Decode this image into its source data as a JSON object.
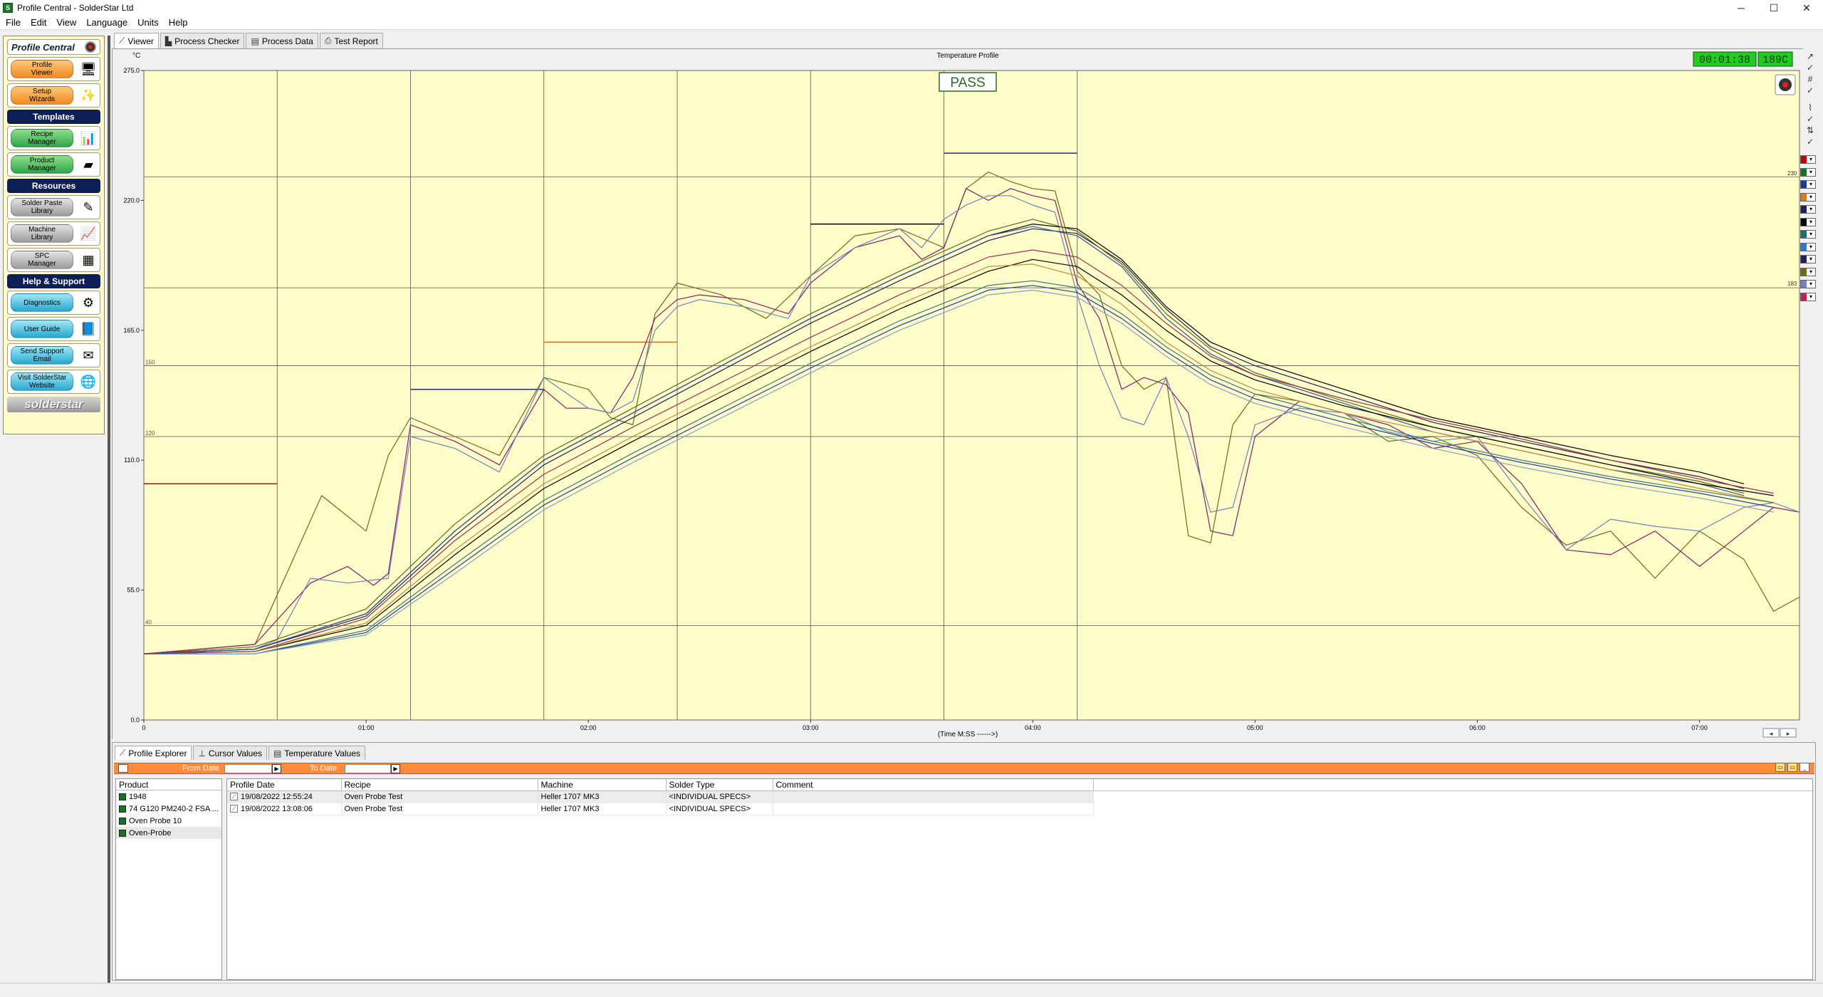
{
  "window": {
    "title": "Profile Central - SolderStar Ltd",
    "app_icon": "S",
    "controls": [
      "─",
      "☐",
      "✕"
    ]
  },
  "menu": [
    "File",
    "Edit",
    "View",
    "Language",
    "Units",
    "Help"
  ],
  "sidebar": {
    "header": "Profile Central",
    "buttons": [
      {
        "label": "Profile\nViewer",
        "color": "orange",
        "icon": "profile-viewer-icon"
      },
      {
        "label": "Setup\nWizards",
        "color": "orange",
        "icon": "wand-icon"
      }
    ],
    "templates_header": "Templates",
    "templates": [
      {
        "label": "Recipe\nManager",
        "color": "green",
        "icon": "recipe-icon"
      },
      {
        "label": "Product\nManager",
        "color": "green",
        "icon": "board-icon"
      }
    ],
    "resources_header": "Resources",
    "resources": [
      {
        "label": "Solder Paste\nLibrary",
        "color": "grey",
        "icon": "paste-icon"
      },
      {
        "label": "Machine\nLibrary",
        "color": "grey",
        "icon": "machine-icon"
      },
      {
        "label": "SPC\nManager",
        "color": "grey",
        "icon": "spc-icon"
      }
    ],
    "help_header": "Help & Support",
    "help": [
      {
        "label": "Diagnostics",
        "color": "blue",
        "icon": "diagnostics-icon"
      },
      {
        "label": "User Guide",
        "color": "blue",
        "icon": "guide-icon"
      },
      {
        "label": "Send Support\nEmail",
        "color": "blue",
        "icon": "email-icon"
      },
      {
        "label": "Visit SolderStar\nWebsite",
        "color": "blue",
        "icon": "globe-icon"
      }
    ],
    "logo": "solderstar"
  },
  "tabs": [
    {
      "label": "Viewer",
      "active": true,
      "icon": "viewer-icon"
    },
    {
      "label": "Process Checker",
      "active": false,
      "icon": "bar-chart-icon"
    },
    {
      "label": "Process Data",
      "active": false,
      "icon": "table-icon"
    },
    {
      "label": "Test Report",
      "active": false,
      "icon": "printer-icon"
    }
  ],
  "graph": {
    "title": "Temperature Profile",
    "status": "PASS",
    "time_readout": "00:01:38",
    "temp_readout": "189C",
    "xlabel": "(Time M:SS ------>)",
    "ylabel": "°C"
  },
  "chart_data": {
    "type": "line",
    "title": "Temperature Profile",
    "xlabel": "(Time M:SS ------>)",
    "ylabel": "°C",
    "xlim": [
      0,
      447
    ],
    "ylim": [
      0,
      275
    ],
    "y_ticks": [
      "0.0",
      "55.0",
      "110.0",
      "165.0",
      "220.0",
      "275.0"
    ],
    "x_ticks": [
      "0",
      "01:00",
      "02:00",
      "03:00",
      "04:00",
      "05:00",
      "06:00",
      "07:00"
    ],
    "x_tick_values": [
      0,
      60,
      120,
      180,
      240,
      300,
      360,
      420
    ],
    "threshold_labels": [
      {
        "y": 40,
        "label": "40"
      },
      {
        "y": 120,
        "label": "120"
      },
      {
        "y": 150,
        "label": "150"
      }
    ],
    "reference_lines": [
      40,
      120,
      150,
      183,
      230
    ],
    "zone_boundaries_s": [
      36,
      72,
      108,
      144,
      180,
      216,
      252
    ],
    "zone_setpoints": [
      {
        "x0": 0,
        "x1": 36,
        "y": 100,
        "color": "#c00000"
      },
      {
        "x0": 72,
        "x1": 108,
        "y": 140,
        "color": "#203080"
      },
      {
        "x0": 108,
        "x1": 144,
        "y": 160,
        "color": "#d07020"
      },
      {
        "x0": 180,
        "x1": 216,
        "y": 210,
        "color": "#000000"
      },
      {
        "x0": 216,
        "x1": 252,
        "y": 240,
        "color": "#203080"
      }
    ],
    "grid": true,
    "series": [
      {
        "color": "#6b6b1a",
        "x": [
          0,
          30,
          48,
          60,
          66,
          72,
          84,
          96,
          108,
          120,
          126,
          132,
          138,
          144,
          156,
          168,
          180,
          192,
          204,
          216,
          222,
          228,
          234,
          240,
          246,
          252,
          258,
          264,
          270,
          276,
          282,
          288,
          294,
          300,
          312,
          324,
          336,
          348,
          360,
          372,
          384,
          396,
          408,
          420,
          432,
          440,
          447
        ],
        "y": [
          28,
          32,
          95,
          80,
          112,
          128,
          120,
          112,
          145,
          140,
          128,
          125,
          172,
          185,
          180,
          170,
          188,
          205,
          208,
          200,
          225,
          232,
          228,
          225,
          224,
          190,
          180,
          150,
          140,
          145,
          78,
          75,
          125,
          138,
          135,
          130,
          118,
          120,
          112,
          90,
          74,
          80,
          60,
          80,
          68,
          46,
          52
        ]
      },
      {
        "color": "#8a1a6a",
        "x": [
          0,
          30,
          45,
          55,
          62,
          66,
          72,
          84,
          96,
          108,
          114,
          120,
          126,
          132,
          138,
          144,
          150,
          162,
          174,
          180,
          192,
          204,
          210,
          216,
          222,
          228,
          234,
          240,
          246,
          252,
          258,
          264,
          270,
          276,
          282,
          288,
          294,
          300,
          312,
          324,
          336,
          348,
          360,
          372,
          384,
          396,
          408,
          420,
          432,
          440,
          447
        ],
        "y": [
          28,
          32,
          58,
          65,
          57,
          62,
          125,
          118,
          108,
          140,
          132,
          132,
          130,
          145,
          170,
          178,
          180,
          178,
          172,
          185,
          200,
          205,
          195,
          200,
          225,
          220,
          225,
          222,
          220,
          185,
          170,
          140,
          145,
          142,
          130,
          80,
          78,
          120,
          135,
          130,
          125,
          115,
          118,
          100,
          72,
          70,
          80,
          65,
          80,
          90,
          88
        ]
      },
      {
        "color": "#7080c0",
        "x": [
          0,
          30,
          36,
          45,
          55,
          66,
          72,
          84,
          96,
          108,
          120,
          126,
          132,
          138,
          144,
          150,
          162,
          174,
          180,
          192,
          204,
          210,
          216,
          222,
          228,
          234,
          240,
          246,
          252,
          258,
          264,
          270,
          276,
          282,
          288,
          294,
          300,
          312,
          324,
          336,
          348,
          360,
          372,
          384,
          396,
          408,
          420,
          432,
          440,
          447
        ],
        "y": [
          28,
          30,
          34,
          60,
          58,
          60,
          120,
          115,
          105,
          145,
          132,
          130,
          135,
          165,
          175,
          178,
          175,
          170,
          188,
          200,
          208,
          200,
          212,
          218,
          222,
          222,
          218,
          215,
          180,
          150,
          128,
          125,
          145,
          120,
          88,
          90,
          125,
          132,
          130,
          122,
          118,
          120,
          95,
          72,
          85,
          82,
          80,
          90,
          92,
          88
        ]
      },
      {
        "color": "#000000",
        "x": [
          0,
          30,
          60,
          84,
          108,
          132,
          156,
          180,
          204,
          228,
          240,
          252,
          264,
          276,
          288,
          300,
          324,
          348,
          372,
          396,
          420,
          432
        ],
        "y": [
          28,
          30,
          45,
          80,
          110,
          130,
          150,
          170,
          188,
          205,
          210,
          208,
          195,
          175,
          160,
          152,
          140,
          128,
          120,
          112,
          105,
          100
        ]
      },
      {
        "color": "#202060",
        "x": [
          0,
          30,
          60,
          84,
          108,
          132,
          156,
          180,
          204,
          228,
          240,
          252,
          264,
          276,
          288,
          300,
          324,
          348,
          372,
          396,
          420,
          432
        ],
        "y": [
          28,
          30,
          44,
          78,
          108,
          128,
          148,
          168,
          186,
          203,
          208,
          206,
          194,
          174,
          158,
          150,
          138,
          126,
          118,
          110,
          103,
          98
        ]
      },
      {
        "color": "#5a6a20",
        "x": [
          0,
          30,
          60,
          84,
          108,
          132,
          156,
          180,
          204,
          228,
          240,
          252,
          264,
          276,
          288,
          300,
          324,
          348,
          372,
          396,
          420,
          432
        ],
        "y": [
          28,
          31,
          47,
          83,
          112,
          132,
          152,
          172,
          190,
          207,
          212,
          207,
          193,
          172,
          157,
          147,
          135,
          124,
          116,
          108,
          101,
          96
        ]
      },
      {
        "color": "#3050a0",
        "x": [
          0,
          30,
          60,
          84,
          108,
          132,
          156,
          180,
          204,
          228,
          240,
          252,
          264,
          276,
          288,
          300,
          324,
          348,
          372,
          396,
          420,
          432
        ],
        "y": [
          28,
          30,
          45,
          80,
          110,
          130,
          150,
          170,
          188,
          205,
          209,
          205,
          192,
          170,
          155,
          146,
          134,
          122,
          114,
          106,
          100,
          95
        ]
      },
      {
        "color": "#000000",
        "x": [
          0,
          30,
          60,
          84,
          108,
          132,
          156,
          180,
          204,
          228,
          240,
          252,
          264,
          276,
          288,
          300,
          324,
          348,
          372,
          396,
          420,
          440
        ],
        "y": [
          28,
          29,
          40,
          70,
          98,
          118,
          137,
          156,
          174,
          190,
          195,
          192,
          180,
          165,
          152,
          144,
          133,
          124,
          116,
          108,
          100,
          95
        ]
      },
      {
        "color": "#c08a40",
        "x": [
          0,
          30,
          60,
          84,
          108,
          132,
          156,
          180,
          204,
          228,
          240,
          252,
          264,
          276,
          288,
          300,
          324,
          348,
          372,
          396,
          420,
          440
        ],
        "y": [
          28,
          29,
          41,
          72,
          100,
          120,
          139,
          158,
          176,
          192,
          193,
          188,
          176,
          160,
          148,
          140,
          130,
          122,
          114,
          106,
          98,
          92
        ]
      },
      {
        "color": "#3a7a80",
        "x": [
          0,
          30,
          60,
          84,
          108,
          132,
          156,
          180,
          204,
          228,
          240,
          252,
          264,
          276,
          288,
          300,
          324,
          348,
          372,
          396,
          420,
          440
        ],
        "y": [
          28,
          28,
          38,
          66,
          93,
          113,
          132,
          151,
          169,
          184,
          186,
          183,
          172,
          158,
          146,
          138,
          128,
          118,
          110,
          103,
          97,
          92
        ]
      },
      {
        "color": "#2040a0",
        "x": [
          0,
          30,
          60,
          84,
          108,
          132,
          156,
          180,
          204,
          228,
          240,
          252,
          264,
          276,
          288,
          300,
          324,
          348,
          372,
          396,
          420,
          440
        ],
        "y": [
          28,
          28,
          37,
          64,
          91,
          111,
          130,
          149,
          167,
          182,
          184,
          181,
          170,
          156,
          144,
          136,
          126,
          117,
          109,
          102,
          96,
          90
        ]
      },
      {
        "color": "#80a0d0",
        "x": [
          0,
          30,
          60,
          84,
          108,
          132,
          156,
          180,
          204,
          228,
          240,
          252,
          264,
          276,
          288,
          300,
          324,
          348,
          372,
          396,
          420,
          440
        ],
        "y": [
          28,
          28,
          36,
          62,
          89,
          109,
          128,
          147,
          165,
          180,
          182,
          179,
          168,
          154,
          142,
          134,
          124,
          115,
          107,
          100,
          94,
          88
        ]
      },
      {
        "color": "#a03050",
        "x": [
          0,
          30,
          60,
          84,
          108,
          132,
          156,
          180,
          204,
          228,
          240,
          252,
          264,
          276,
          288,
          300,
          324,
          348,
          372,
          396,
          420,
          440
        ],
        "y": [
          28,
          29,
          43,
          76,
          104,
          124,
          143,
          162,
          180,
          196,
          199,
          196,
          184,
          168,
          154,
          146,
          136,
          127,
          119,
          110,
          102,
          96
        ]
      }
    ]
  },
  "right_toolbar": [
    "↗",
    "✓",
    "#",
    "✓",
    "⌇",
    "✓",
    "⇅",
    "✓"
  ],
  "probe_colors": [
    "#c00000",
    "#1a6e2a",
    "#1a3aa0",
    "#d08020",
    "#202060",
    "#000000",
    "#1a6e6e",
    "#2a7ad0",
    "#202060",
    "#6b6b1a",
    "#7080c0",
    "#c02060"
  ],
  "probe_markers": {
    "p230": "230",
    "p183": "183"
  },
  "bottom": {
    "tabs": [
      {
        "label": "Profile Explorer",
        "active": true,
        "icon": "explorer-icon"
      },
      {
        "label": "Cursor Values",
        "active": false,
        "icon": "cursor-icon"
      },
      {
        "label": "Temperature Values",
        "active": false,
        "icon": "temp-table-icon"
      }
    ],
    "filter": {
      "from_label": "From Date",
      "to_label": "To Date"
    },
    "product_header": "Product",
    "products": [
      {
        "name": "1948",
        "selected": false
      },
      {
        "name": "74 G120 PM240-2 FSA ...",
        "selected": false
      },
      {
        "name": "Oven Probe 10",
        "selected": false
      },
      {
        "name": "Oven-Probe",
        "selected": true
      }
    ],
    "columns": [
      "Profile Date",
      "Recipe",
      "Machine",
      "Solder Type",
      "Comment"
    ],
    "rows": [
      {
        "date": "19/08/2022 12:55:24",
        "recipe": "Oven Probe Test",
        "machine": "Heller 1707 MK3",
        "solder": "<INDIVIDUAL SPECS>",
        "comment": ""
      },
      {
        "date": "19/08/2022 13:08:06",
        "recipe": "Oven Probe Test",
        "machine": "Heller 1707 MK3",
        "solder": "<INDIVIDUAL SPECS>",
        "comment": ""
      }
    ]
  }
}
